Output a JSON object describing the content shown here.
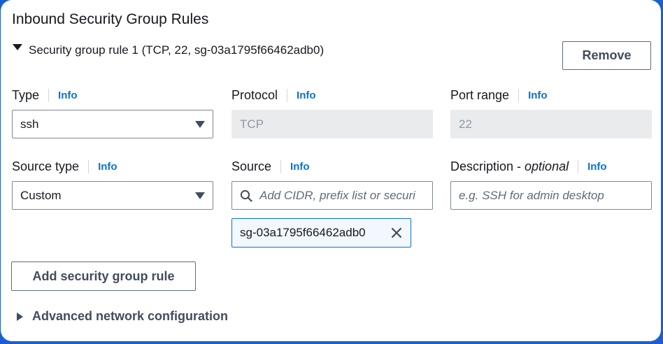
{
  "section": {
    "title": "Inbound Security Group Rules"
  },
  "rule": {
    "header": "Security group rule 1 (TCP, 22, sg-03a1795f66462adb0)",
    "remove_label": "Remove"
  },
  "fields": {
    "type": {
      "label": "Type",
      "info": "Info",
      "value": "ssh"
    },
    "protocol": {
      "label": "Protocol",
      "info": "Info",
      "value": "TCP"
    },
    "port_range": {
      "label": "Port range",
      "info": "Info",
      "value": "22"
    },
    "source_type": {
      "label": "Source type",
      "info": "Info",
      "value": "Custom"
    },
    "source": {
      "label": "Source",
      "info": "Info",
      "placeholder": "Add CIDR, prefix list or securi",
      "token": "sg-03a1795f66462adb0"
    },
    "description": {
      "label": "Description -",
      "label_optional": "optional",
      "info": "Info",
      "placeholder": "e.g. SSH for admin desktop"
    }
  },
  "actions": {
    "add_rule_label": "Add security group rule"
  },
  "advanced": {
    "label": "Advanced network configuration"
  },
  "colors": {
    "accent": "#0972d3",
    "background": "#1a5fd0"
  }
}
